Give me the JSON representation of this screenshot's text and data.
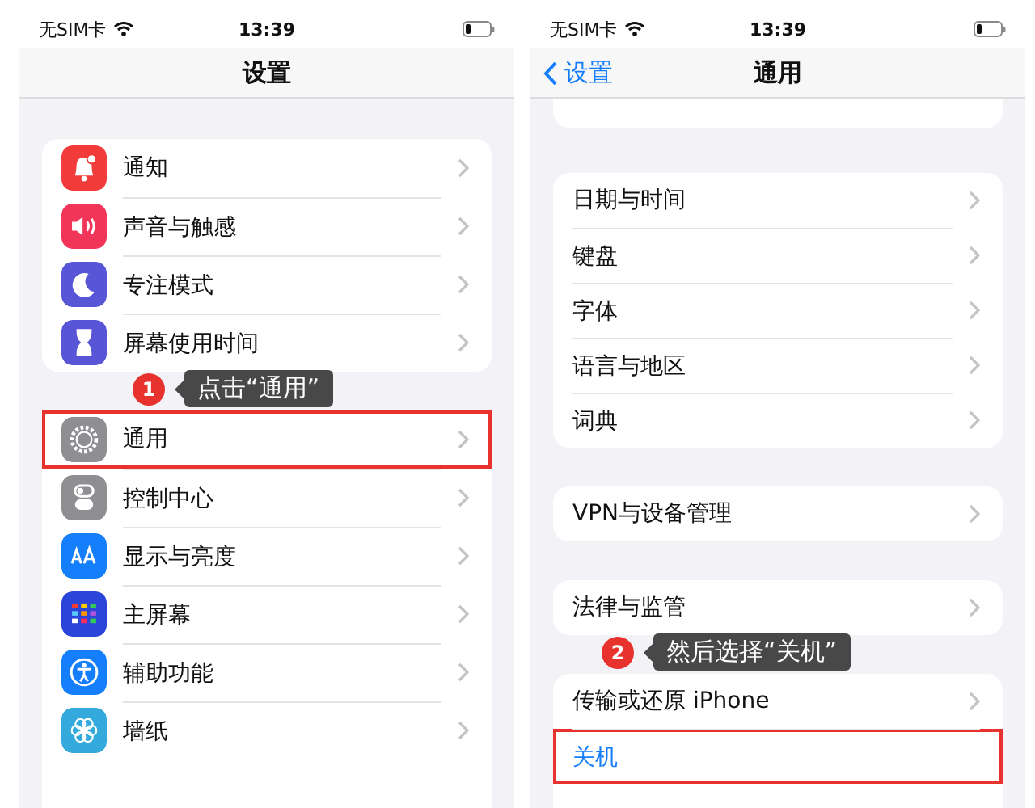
{
  "phones": [
    {
      "status_bar": {
        "carrier": "无SIM卡",
        "time": "13:39"
      },
      "nav": {
        "title": "设置"
      },
      "sections": [
        {
          "items": [
            {
              "label": "通知",
              "highlighted": false,
              "kind": "nav"
            },
            {
              "label": "声音与触感",
              "highlighted": false,
              "kind": "nav"
            },
            {
              "label": "专注模式",
              "highlighted": false,
              "kind": "nav"
            },
            {
              "label": "屏幕使用时间",
              "highlighted": false,
              "kind": "nav"
            }
          ]
        },
        {
          "items": [
            {
              "label": "通用",
              "highlighted": true,
              "kind": "nav"
            },
            {
              "label": "控制中心",
              "highlighted": false,
              "kind": "nav"
            },
            {
              "label": "显示与亮度",
              "highlighted": false,
              "kind": "nav"
            },
            {
              "label": "主屏幕",
              "highlighted": false,
              "kind": "nav"
            },
            {
              "label": "辅助功能",
              "highlighted": false,
              "kind": "nav"
            },
            {
              "label": "墙纸",
              "highlighted": false,
              "kind": "nav"
            }
          ]
        }
      ],
      "callout": {
        "number": "1",
        "text": "点击“通用”"
      }
    },
    {
      "status_bar": {
        "carrier": "无SIM卡",
        "time": "13:39"
      },
      "nav": {
        "back": "设置",
        "title": "通用"
      },
      "clipped_card_top": true,
      "sections": [
        {
          "items": [
            {
              "label": "日期与时间",
              "highlighted": false,
              "kind": "nav"
            },
            {
              "label": "键盘",
              "highlighted": false,
              "kind": "nav"
            },
            {
              "label": "字体",
              "highlighted": false,
              "kind": "nav"
            },
            {
              "label": "语言与地区",
              "highlighted": false,
              "kind": "nav"
            },
            {
              "label": "词典",
              "highlighted": false,
              "kind": "nav"
            }
          ]
        },
        {
          "items": [
            {
              "label": "VPN与设备管理",
              "highlighted": false,
              "kind": "nav"
            }
          ]
        },
        {
          "items": [
            {
              "label": "法律与监管",
              "highlighted": false,
              "kind": "nav"
            }
          ]
        },
        {
          "items": [
            {
              "label": "传输或还原 iPhone",
              "highlighted": false,
              "kind": "nav"
            },
            {
              "label": "关机",
              "highlighted": true,
              "kind": "action"
            }
          ]
        }
      ],
      "callout": {
        "number": "2",
        "text": "然后选择“关机”"
      }
    }
  ]
}
